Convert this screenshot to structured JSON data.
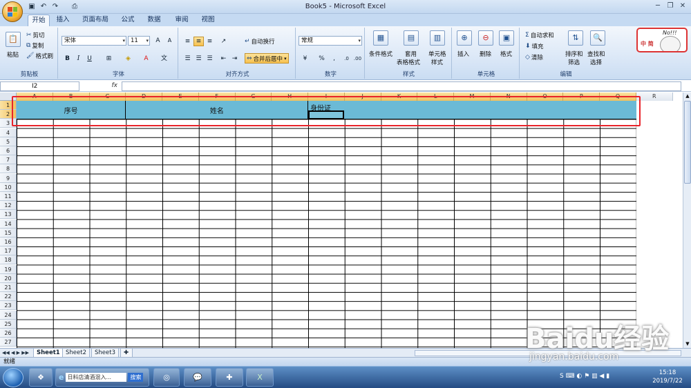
{
  "window": {
    "title": "Book5 - Microsoft Excel"
  },
  "tabs": [
    {
      "label": "开始",
      "active": true
    },
    {
      "label": "插入"
    },
    {
      "label": "页面布局"
    },
    {
      "label": "公式"
    },
    {
      "label": "数据"
    },
    {
      "label": "审阅"
    },
    {
      "label": "视图"
    }
  ],
  "ribbon": {
    "clipboard": {
      "paste": "粘贴",
      "cut": "剪切",
      "copy": "复制",
      "format_painter": "格式刷",
      "label": "剪贴板"
    },
    "font": {
      "name": "宋体",
      "size": "11",
      "bold": "B",
      "italic": "I",
      "underline": "U",
      "label": "字体"
    },
    "alignment": {
      "wrap_text": "自动换行",
      "merge_center": "合并后居中",
      "label": "对齐方式"
    },
    "number": {
      "format": "常规",
      "percent": "%",
      "label": "数字"
    },
    "styles": {
      "conditional": "条件格式",
      "table_line1": "套用",
      "table_line2": "表格格式",
      "cell_line1": "单元格",
      "cell_line2": "样式",
      "label": "样式"
    },
    "cells": {
      "insert": "插入",
      "delete": "删除",
      "format": "格式",
      "label": "单元格"
    },
    "editing": {
      "autosum": "自动求和",
      "fill": "填充",
      "clear": "清除",
      "sort_line1": "排序和",
      "sort_line2": "筛选",
      "find_line1": "查找和",
      "find_line2": "选择",
      "label": "编辑"
    }
  },
  "formula_bar": {
    "name_box": "I2",
    "fx": "fx",
    "value": ""
  },
  "columns": [
    "A",
    "B",
    "C",
    "D",
    "E",
    "F",
    "G",
    "H",
    "I",
    "J",
    "K",
    "L",
    "M",
    "N",
    "O",
    "P",
    "Q",
    "R"
  ],
  "rows": [
    "1",
    "2",
    "3",
    "4",
    "5",
    "6",
    "7",
    "8",
    "9",
    "10",
    "11",
    "12",
    "13",
    "14",
    "15",
    "16",
    "17",
    "18",
    "19",
    "20",
    "21",
    "22",
    "23",
    "24",
    "25",
    "26",
    "27"
  ],
  "cells": {
    "seq": "序号",
    "name": "姓名",
    "id": "身份证"
  },
  "sheets": [
    "Sheet1",
    "Sheet2",
    "Sheet3"
  ],
  "status": {
    "ready": "就绪"
  },
  "mascot": {
    "text": "No!!!",
    "badge": "中 简"
  },
  "taskbar": {
    "browser_text": "日料店清酒混入...",
    "search": "搜索",
    "time": "15:18",
    "date": "2019/7/22"
  },
  "watermark": {
    "brand": "Baidu经验",
    "url": "jingyan.baidu.com"
  },
  "colors": {
    "header_fill": "#6bbad6",
    "highlight_box": "#e8232a",
    "ribbon_bg": "#d7e5f6"
  }
}
